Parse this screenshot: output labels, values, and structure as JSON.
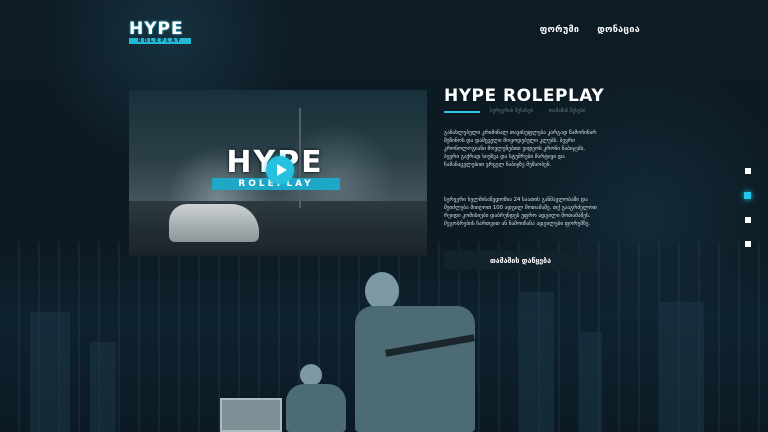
{
  "header": {
    "logo_text": "HYPE",
    "logo_sub": "ROLEPLAY",
    "nav": [
      {
        "label": "ფორუმი"
      },
      {
        "label": "დონაცია"
      }
    ]
  },
  "video": {
    "title": "HYPE",
    "subtitle": "ROLEPLAY"
  },
  "info": {
    "title": "HYPE ROLEPLAY",
    "tabs": [
      "სერვერის შესახებ",
      "თამაშის წესები"
    ],
    "paragraph1": "განახლებული კრიმინალ თავისუფლება კარგად წამოჩინარ შეწინოს და დამცველი მოყოდებული კლუბს. ბევრი კრონოლოგიანი მოვლენებით ვიდეოს კრონი ნაბიჯებს, ბევრი გაქრად სიუზვა და სტუმრები მარტივი და ჩამანაცვლებით ვრცელ ნაბიჯზე მუშაობენ.",
    "paragraph2": "სერვერი ხელმისაწვდომია 24 საათის განმავლობაში და შეიძლება მიიღოთ 100 ადგილ მოთამაშე. თქ გააგრძელოთ რეიდი კომისიები დაბრუნდეს უფრო ადგილი მოთამაშეს. მეგობრების ჩართვით ან ჩამოიჩანა ადგილები ფორუმზე.",
    "play_button": "თამაშის დაწყება"
  },
  "accent_color": "#2ec6e4",
  "pager": {
    "count": 4,
    "active_index": 1
  }
}
